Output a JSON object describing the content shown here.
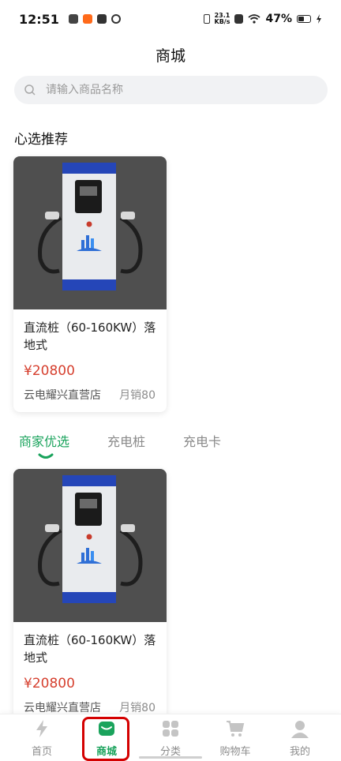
{
  "status_bar": {
    "time": "12:51",
    "net_speed_value": "23.1",
    "net_speed_unit": "KB/s",
    "battery_percent": "47%"
  },
  "header": {
    "title": "商城"
  },
  "search": {
    "placeholder": "请输入商品名称"
  },
  "featured": {
    "section_title": "心选推荐",
    "product": {
      "name": "直流桩（60-160KW）落地式",
      "price": "¥20800",
      "store": "云电耀兴直营店",
      "sales": "月销80"
    }
  },
  "tabs": {
    "items": [
      "商家优选",
      "充电桩",
      "充电卡"
    ],
    "active_index": 0
  },
  "list": {
    "product": {
      "name": "直流桩（60-160KW）落地式",
      "price": "¥20800",
      "store": "云电耀兴直营店",
      "sales": "月销80"
    }
  },
  "bottom_nav": {
    "items": [
      {
        "label": "首页",
        "icon": "lightning-icon"
      },
      {
        "label": "商城",
        "icon": "shop-icon"
      },
      {
        "label": "分类",
        "icon": "grid-icon"
      },
      {
        "label": "购物车",
        "icon": "cart-icon"
      },
      {
        "label": "我的",
        "icon": "user-icon"
      }
    ],
    "active_index": 1
  },
  "colors": {
    "accent": "#1aa35c",
    "price": "#d6402f",
    "highlight_box": "#d40000"
  }
}
